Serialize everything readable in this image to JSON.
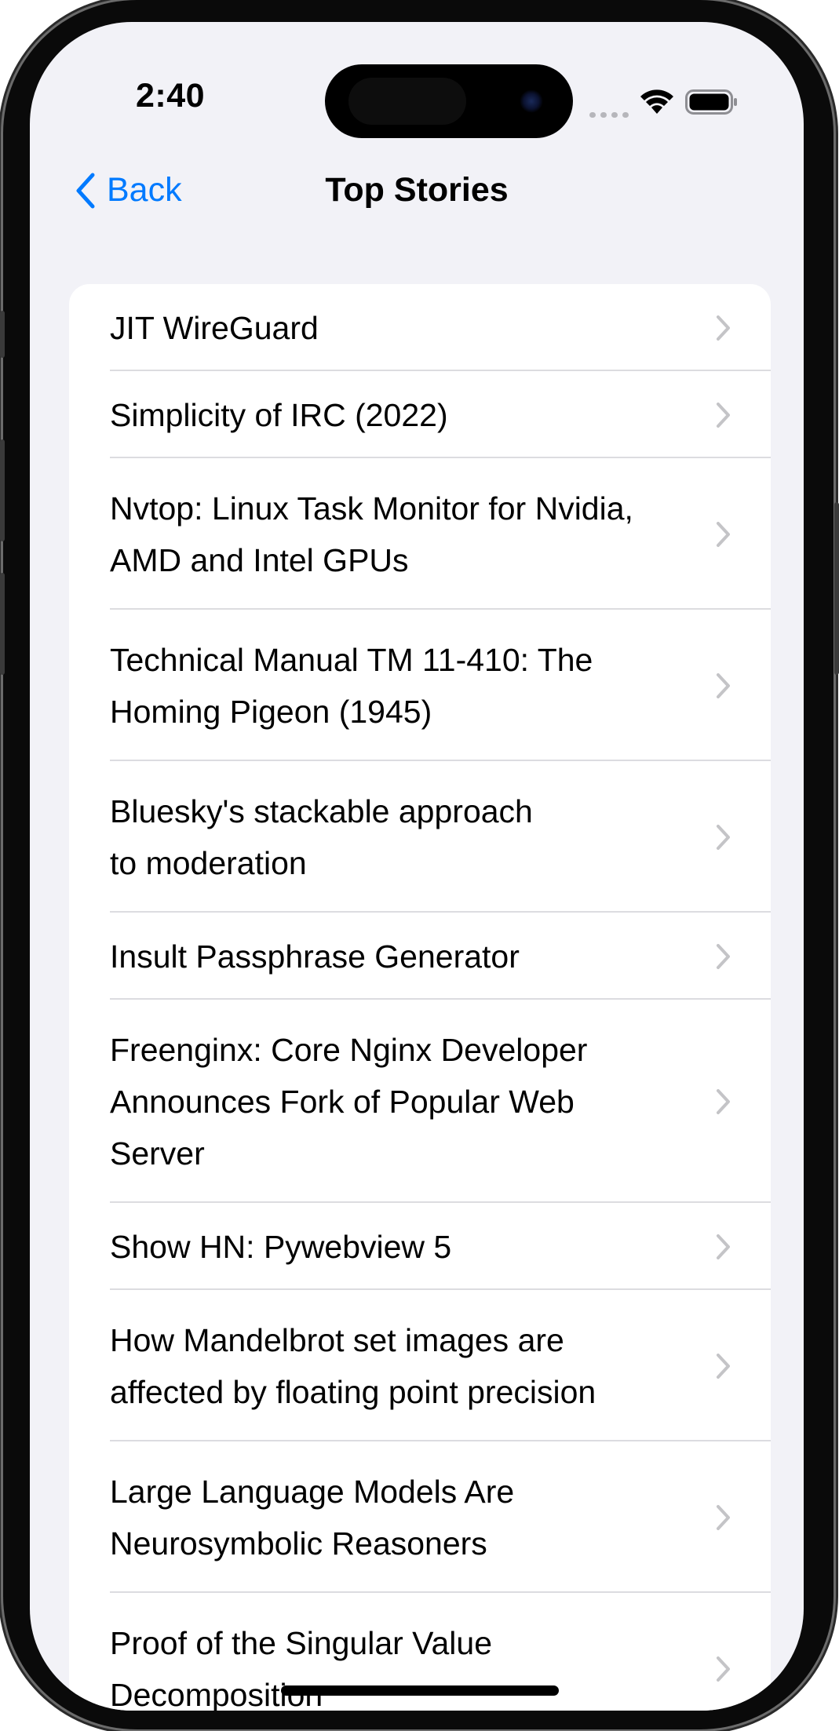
{
  "status_bar": {
    "time": "2:40"
  },
  "nav": {
    "back_label": "Back",
    "title": "Top Stories"
  },
  "colors": {
    "accent": "#007aff",
    "background": "#f2f2f7",
    "card": "#ffffff",
    "chevron": "#c4c4c7"
  },
  "stories": [
    {
      "title": "JIT WireGuard"
    },
    {
      "title": "Simplicity of IRC (2022)"
    },
    {
      "title": "Nvtop: Linux Task Monitor for Nvidia, AMD and Intel GPUs"
    },
    {
      "title": "Technical Manual TM 11-410: The Homing Pigeon (1945)"
    },
    {
      "title": "Bluesky's stackable approach to moderation"
    },
    {
      "title": "Insult Passphrase Generator"
    },
    {
      "title": "Freenginx: Core Nginx Developer Announces Fork of Popular Web Server"
    },
    {
      "title": "Show HN: Pywebview 5"
    },
    {
      "title": "How Mandelbrot set images are affected by floating point precision"
    },
    {
      "title": "Large Language Models Are Neurosymbolic Reasoners"
    },
    {
      "title": "Proof of the Singular Value Decomposition"
    }
  ],
  "icons": {
    "back": "chevron-left-icon",
    "row": "chevron-right-icon",
    "wifi": "wifi-icon",
    "battery": "battery-icon",
    "signal": "cellular-signal-icon"
  }
}
